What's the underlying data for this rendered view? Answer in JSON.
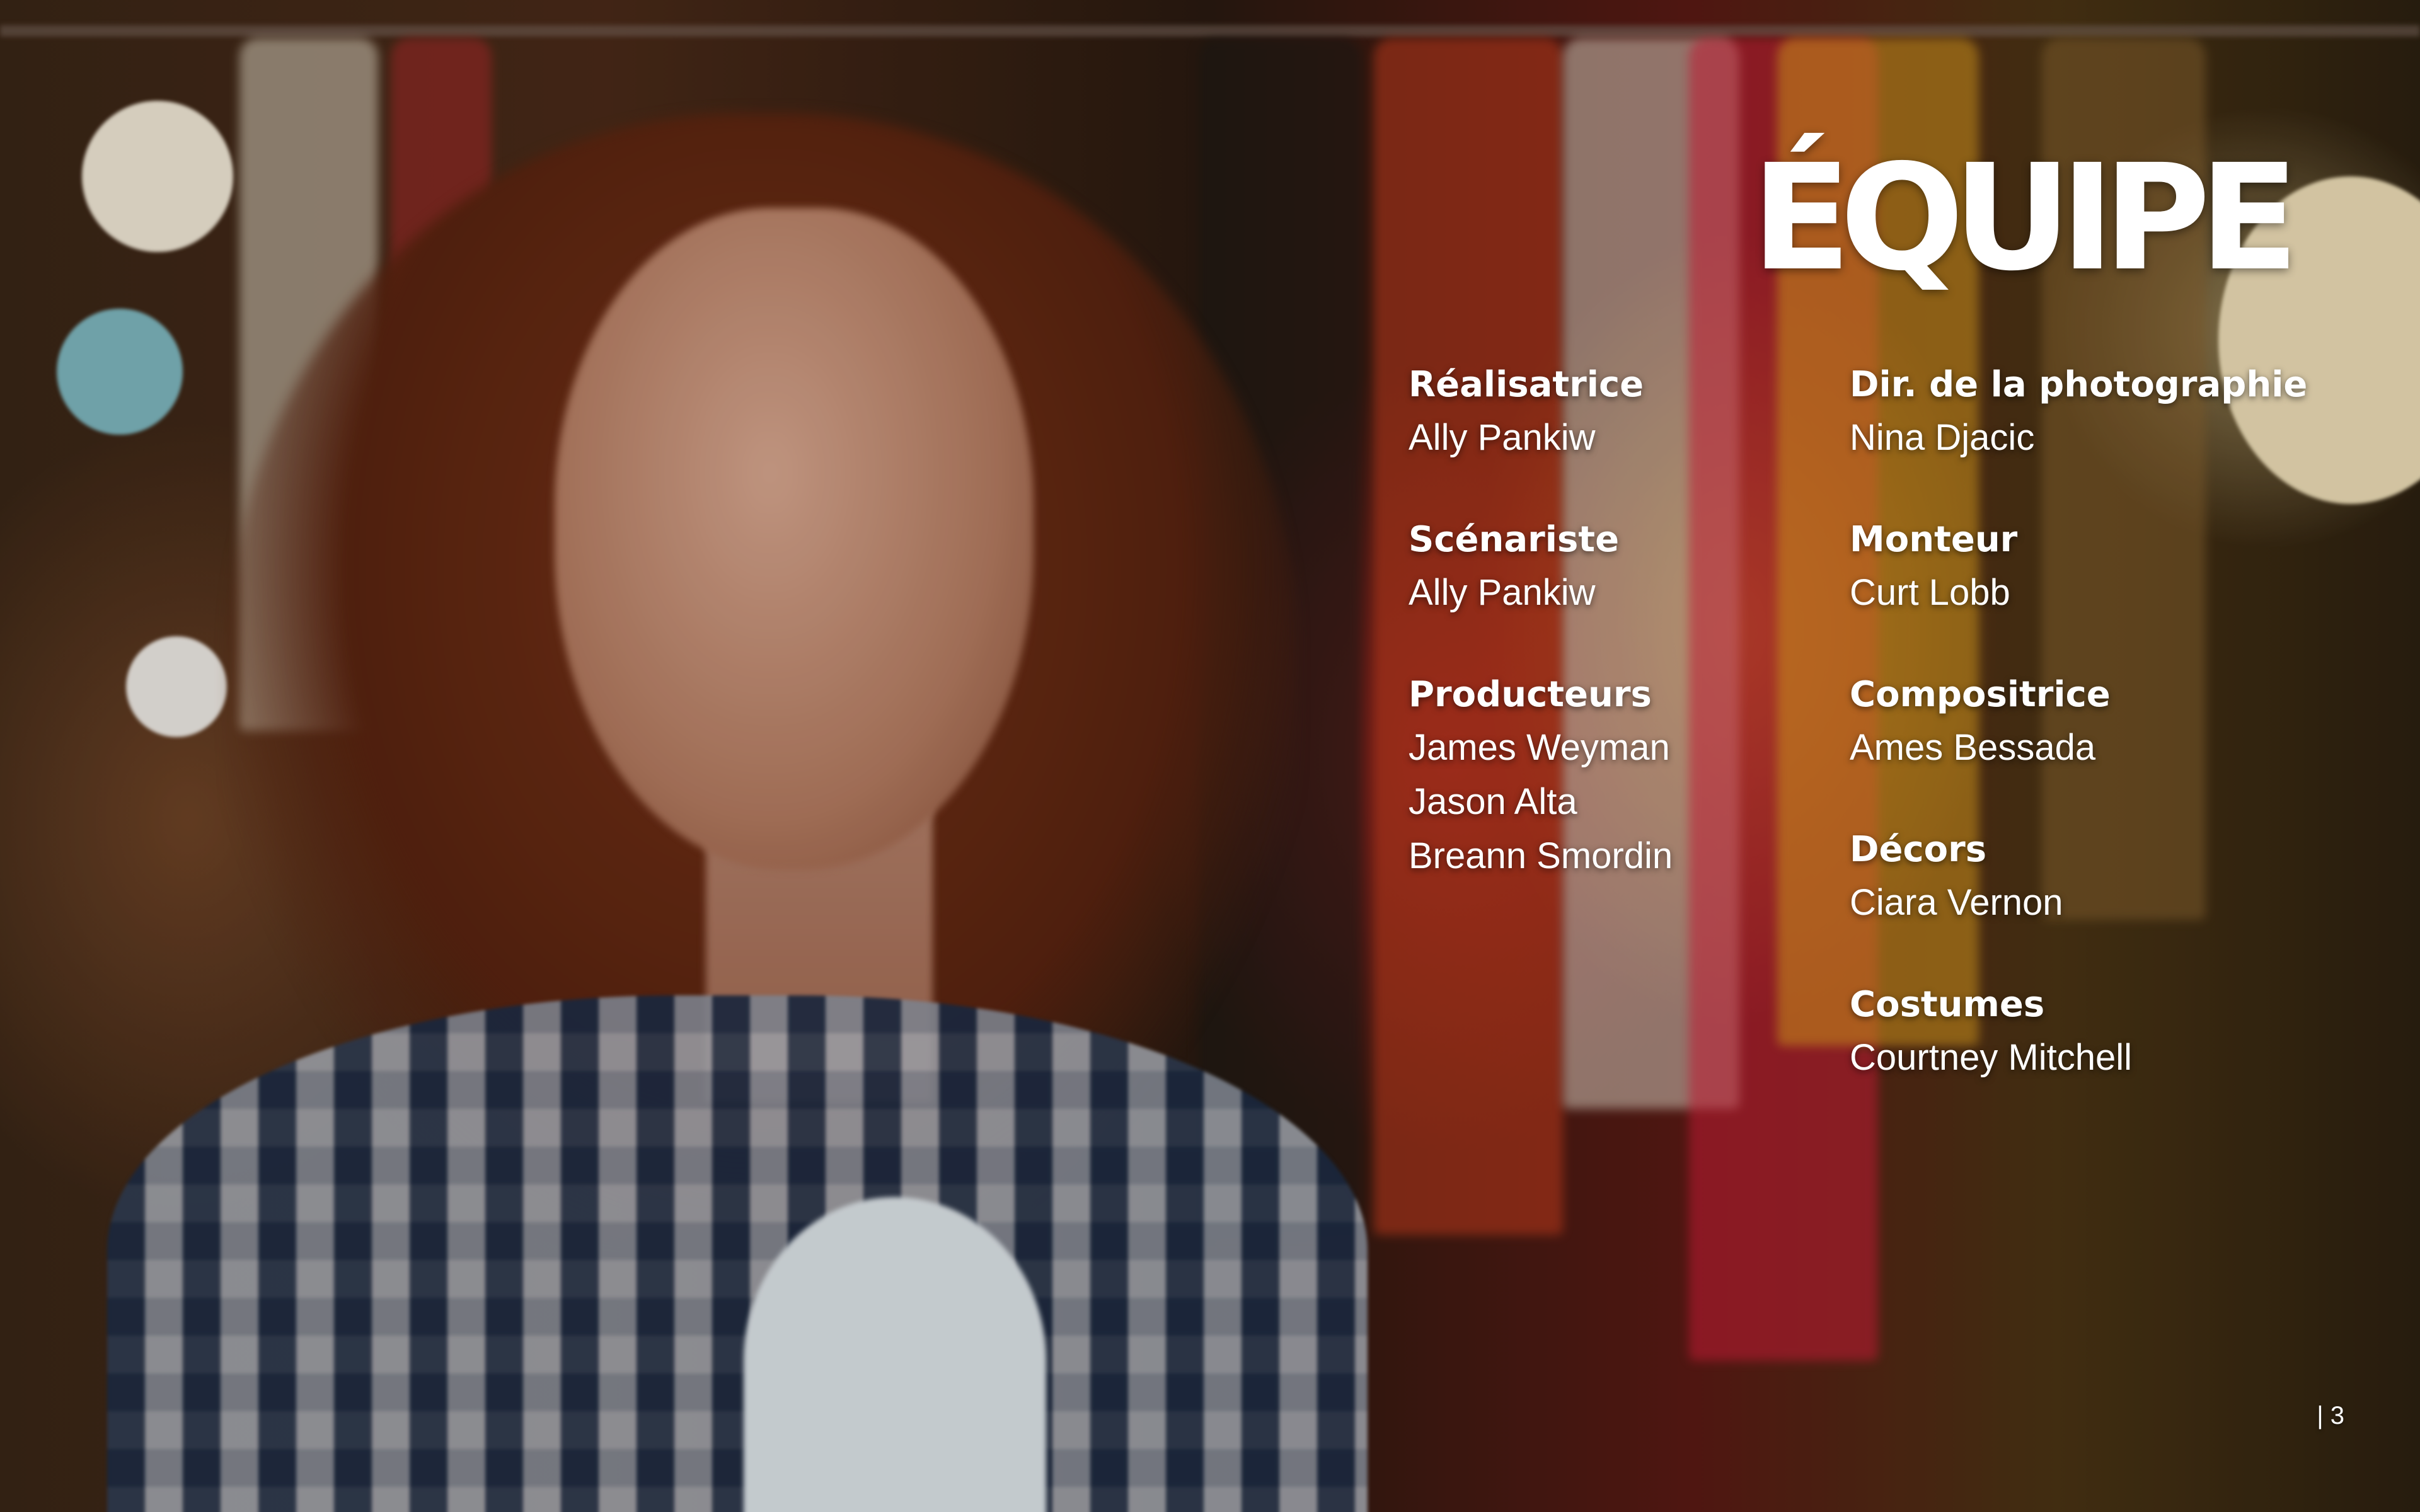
{
  "title": "ÉQUIPE",
  "page_number": "| 3",
  "crew_left": [
    {
      "role": "Réalisatrice",
      "names": [
        "Ally Pankiw"
      ]
    },
    {
      "role": "Scénariste",
      "names": [
        "Ally Pankiw"
      ]
    },
    {
      "role": "Producteurs",
      "names": [
        "James Weyman",
        "Jason Alta",
        "Breann Smordin"
      ]
    }
  ],
  "crew_right": [
    {
      "role": "Dir. de la photographie",
      "names": [
        "Nina Djacic"
      ]
    },
    {
      "role": "Monteur",
      "names": [
        "Curt Lobb"
      ]
    },
    {
      "role": "Compositrice",
      "names": [
        "Ames Bessada"
      ]
    },
    {
      "role": "Décors",
      "names": [
        "Ciara Vernon"
      ]
    },
    {
      "role": "Costumes",
      "names": [
        "Courtney Mitchell"
      ]
    }
  ]
}
